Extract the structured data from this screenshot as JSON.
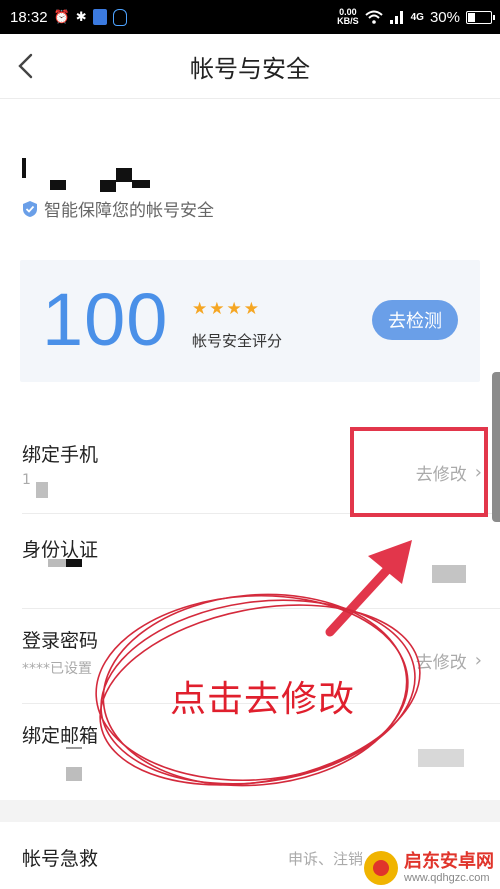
{
  "status_bar": {
    "time": "18:32",
    "net_speed": "0.00",
    "net_unit": "KB/S",
    "network": "4G",
    "battery": "30%",
    "battery_level": 0.3,
    "icons": [
      "alarm-icon",
      "bluetooth-icon",
      "shield-app-icon",
      "qq-icon",
      "wifi-icon",
      "signal-icon",
      "battery-icon"
    ]
  },
  "nav": {
    "title": "帐号与安全",
    "back_icon": "chevron-left-icon"
  },
  "profile": {
    "tagline": "智能保障您的帐号安全"
  },
  "score_card": {
    "score": "100",
    "stars": 4,
    "label": "帐号安全评分",
    "button": "去检测"
  },
  "items": [
    {
      "label": "绑定手机",
      "sub": "1",
      "action": "去修改"
    },
    {
      "label": "身份认证",
      "sub": "",
      "action": ""
    },
    {
      "label": "登录密码",
      "sub": "****已设置",
      "action": "去修改"
    },
    {
      "label": "绑定邮箱",
      "sub": "",
      "action": ""
    }
  ],
  "rescue": {
    "label": "帐号急救",
    "action": "申诉、注销"
  },
  "annotation": {
    "text": "点击去修改",
    "color": "#e01f2d"
  },
  "watermark": {
    "name": "启东安卓网",
    "url": "www.qdhgzc.com"
  },
  "colors": {
    "accent": "#4a90e8",
    "button": "#6a9fe8",
    "star": "#f5a623",
    "highlight": "#e2364b"
  }
}
